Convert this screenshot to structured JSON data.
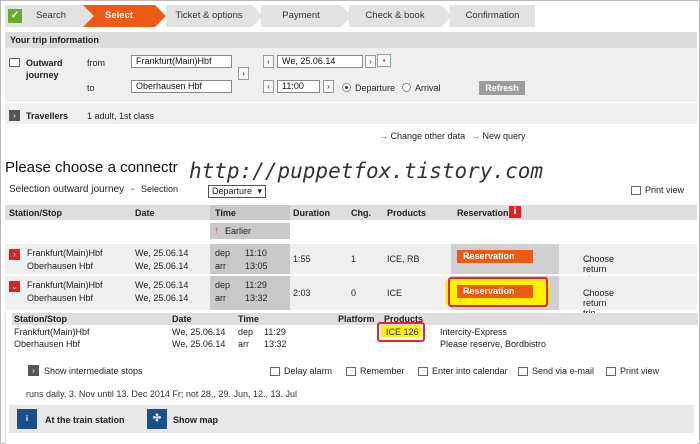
{
  "steps": [
    "Search",
    "Select",
    "Ticket & options",
    "Payment",
    "Check & book",
    "Confirmation"
  ],
  "trip": {
    "title": "Your trip information",
    "outward": "Outward journey",
    "from_label": "from",
    "from_value": "Frankfurt(Main)Hbf",
    "to_label": "to",
    "to_value": "Oberhausen Hbf",
    "date_value": "We, 25.06.14",
    "time_value": "11:00",
    "departure_label": "Departure",
    "arrival_label": "Arrival",
    "refresh_label": "Refresh",
    "travellers_label": "Travellers",
    "travellers_value": "1 adult, 1st class",
    "change_other": "Change other data",
    "new_query": "New query"
  },
  "heading": "Please choose a connect",
  "heading_tail": "r",
  "watermark": "http://puppetfox.tistory.com",
  "selection": {
    "label": "Selection outward journey",
    "dash": "-",
    "mode_label": "Selection",
    "mode_value": "Departure",
    "print_view": "Print view"
  },
  "table": {
    "headers": [
      "Station/Stop",
      "Date",
      "Time",
      "Duration",
      "Chg.",
      "Products",
      "Reservation"
    ],
    "earlier": "Earlier",
    "rows": [
      {
        "from": "Frankfurt(Main)Hbf",
        "to": "Oberhausen Hbf",
        "date1": "We, 25.06.14",
        "date2": "We, 25.06.14",
        "dep": "dep",
        "arr": "arr",
        "t1": "11:10",
        "t2": "13:05",
        "duration": "1:55",
        "changes": "1",
        "products": "ICE, RB",
        "reservation": "Reservation",
        "return": "Choose return trip"
      },
      {
        "from": "Frankfurt(Main)Hbf",
        "to": "Oberhausen Hbf",
        "date1": "We, 25.06.14",
        "date2": "We, 25.06.14",
        "dep": "dep",
        "arr": "arr",
        "t1": "11:29",
        "t2": "13:32",
        "duration": "2:03",
        "changes": "0",
        "products": "ICE",
        "reservation": "Reservation",
        "return": "Choose return trip"
      }
    ]
  },
  "detail": {
    "headers": [
      "Station/Stop",
      "Date",
      "Time",
      "Platform",
      "Products"
    ],
    "from": "Frankfurt(Main)Hbf",
    "to": "Oberhausen Hbf",
    "date1": "We, 25.06.14",
    "date2": "We, 25.06.14",
    "dep": "dep",
    "arr": "arr",
    "t1": "11:29",
    "t2": "13:32",
    "train": "ICE 126",
    "train_type": "Intercity-Express",
    "notes": "Please reserve, Bordbistro",
    "show_stops": "Show intermediate stops",
    "delay_alarm": "Delay alarm",
    "remember": "Remember",
    "calendar": "Enter into calendar",
    "email": "Send via e-mail",
    "print": "Print view",
    "runs": "runs daily, 3. Nov until 13. Dec 2014 Fr; not 28., 29. Jun, 12., 13. Jul",
    "at_station": "At the train station",
    "show_map": "Show map"
  },
  "colors": {
    "accent": "#ec5a13",
    "red": "#d8232a",
    "highlight": "#fff200"
  }
}
